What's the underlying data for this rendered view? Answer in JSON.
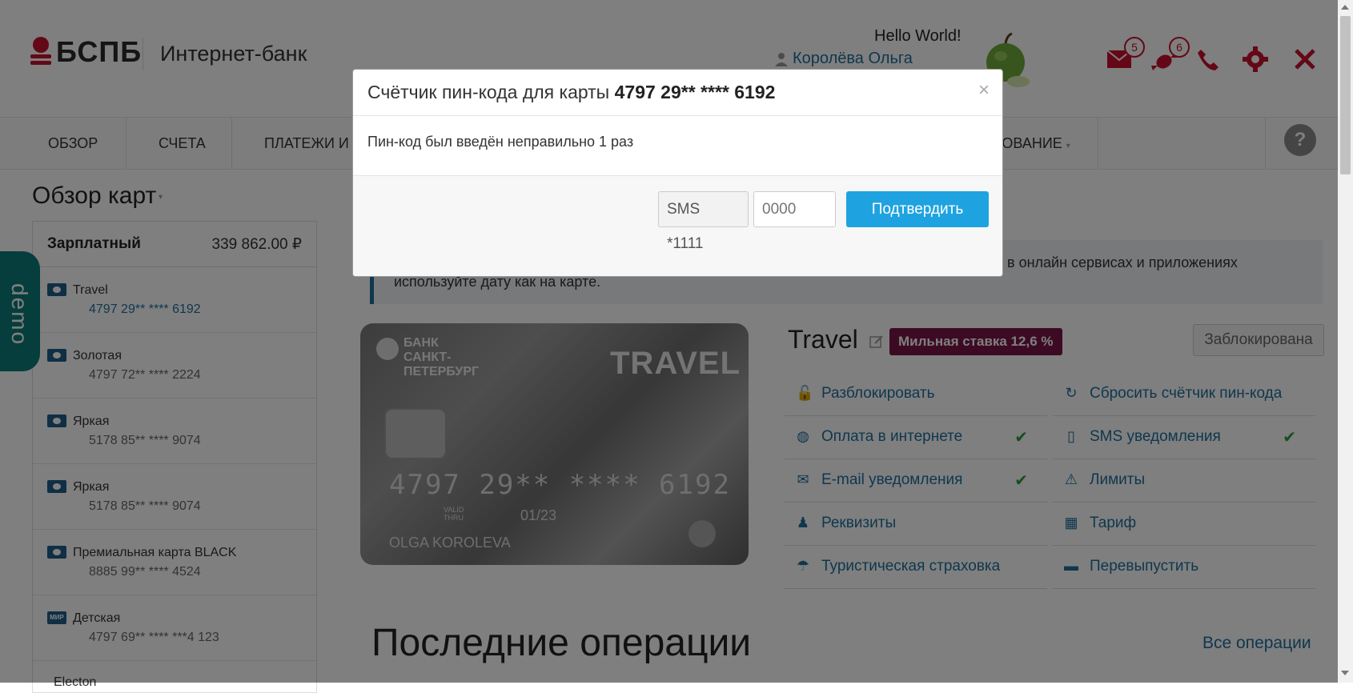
{
  "header": {
    "logo_text": "БСПБ",
    "subtitle": "Интернет-банк",
    "greeting": "Hello World!",
    "user_name": "Королёва Ольга",
    "mail_count": "5",
    "gift_count": "6"
  },
  "nav": {
    "items": [
      "ОБЗОР",
      "СЧЕТА",
      "ПЛАТЕЖИ И П",
      "ХОВАНИЕ"
    ],
    "help": "?"
  },
  "sidebar": {
    "title": "Обзор карт",
    "account_name": "Зарплатный",
    "account_balance": "339 862.00 ₽",
    "cards": [
      {
        "name": "Travel",
        "number": "4797 29** **** 6192"
      },
      {
        "name": "Золотая",
        "number": "4797 72** **** 2224"
      },
      {
        "name": "Яркая",
        "number": "5178 85** **** 9074"
      },
      {
        "name": "Яркая",
        "number": "5178 85** **** 9074"
      },
      {
        "name": "Премиальная карта BLACK",
        "number": "8885 99** **** 4524"
      },
      {
        "name": "Детская",
        "number": "4797 69** **** ***4 123"
      },
      {
        "name": "Electon",
        "number": ""
      }
    ],
    "mir_label": "МИР"
  },
  "demo_label": "demo",
  "notice": {
    "line1": "в онлайн сервисах и приложениях",
    "line2": "используйте дату как на карте."
  },
  "card_image": {
    "bank_line1": "БАНК",
    "bank_line2": "САНКТ-",
    "bank_line3": "ПЕТЕРБУРГ",
    "brand": "TRAVEL",
    "number": "4797 29** **** 6192",
    "valid_label1": "VALID",
    "valid_label2": "THRU",
    "expiry": "01/23",
    "holder": "OLGA KOROLEVA"
  },
  "card_detail": {
    "title": "Travel",
    "rate_badge": "Мильная ставка 12,6 %",
    "status": "Заблокирована",
    "actions_left": [
      {
        "label": "Разблокировать",
        "checked": false
      },
      {
        "label": "Оплата в интернете",
        "checked": true
      },
      {
        "label": "E-mail уведомления",
        "checked": true
      },
      {
        "label": "Реквизиты",
        "checked": false
      },
      {
        "label": "Туристическая страховка",
        "checked": false
      }
    ],
    "actions_right": [
      {
        "label": "Сбросить счётчик пин-кода",
        "checked": false
      },
      {
        "label": "SMS уведомления",
        "checked": true
      },
      {
        "label": "Лимиты",
        "checked": false
      },
      {
        "label": "Тариф",
        "checked": false
      },
      {
        "label": "Перевыпустить",
        "checked": false
      }
    ]
  },
  "operations": {
    "title": "Последние операции",
    "all_link": "Все операции"
  },
  "modal": {
    "title_prefix": "Счётчик пин-кода для карты",
    "title_card": "4797 29** **** 6192",
    "close": "×",
    "message": "Пин-код был введён неправильно 1 раз",
    "sms_label": "SMS *1111",
    "code_placeholder": "0000",
    "confirm_label": "Подтвердить"
  },
  "colors": {
    "brand_red": "#c8102e",
    "link_blue": "#1f6f9c",
    "confirm_blue": "#1fa3e0",
    "rate_badge": "#7a1446",
    "demo_teal": "#0a7c78"
  }
}
